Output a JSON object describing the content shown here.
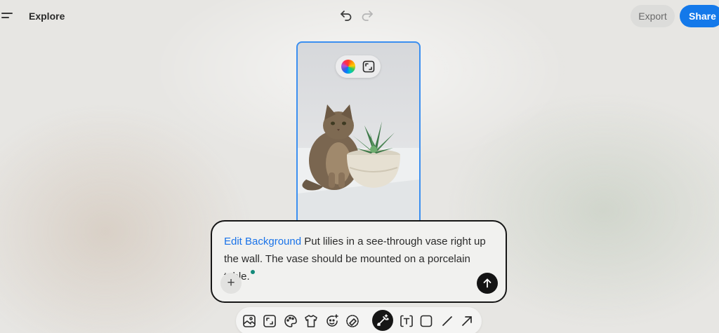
{
  "header": {
    "title": "Explore",
    "export_label": "Export",
    "share_label": "Share"
  },
  "prompt": {
    "tag": "Edit Background",
    "text": " Put lilies in a see-through vase right up the wall. The vase should be mounted on a porcelain table.",
    "add_label": "+"
  },
  "colors": {
    "accent": "#1479ea",
    "selection_border": "#3b8ff0",
    "tag_text": "#1a73e8",
    "cursor_dot": "#138a7a"
  },
  "toolbar": {
    "tools": [
      "image-edit-icon",
      "resize-icon",
      "palette-icon",
      "shirt-icon",
      "sparkle-face-icon",
      "eraser-icon",
      "magic-brush-icon",
      "text-icon",
      "rectangle-icon",
      "line-icon",
      "arrow-icon"
    ],
    "active_tool": "magic-brush-icon"
  }
}
